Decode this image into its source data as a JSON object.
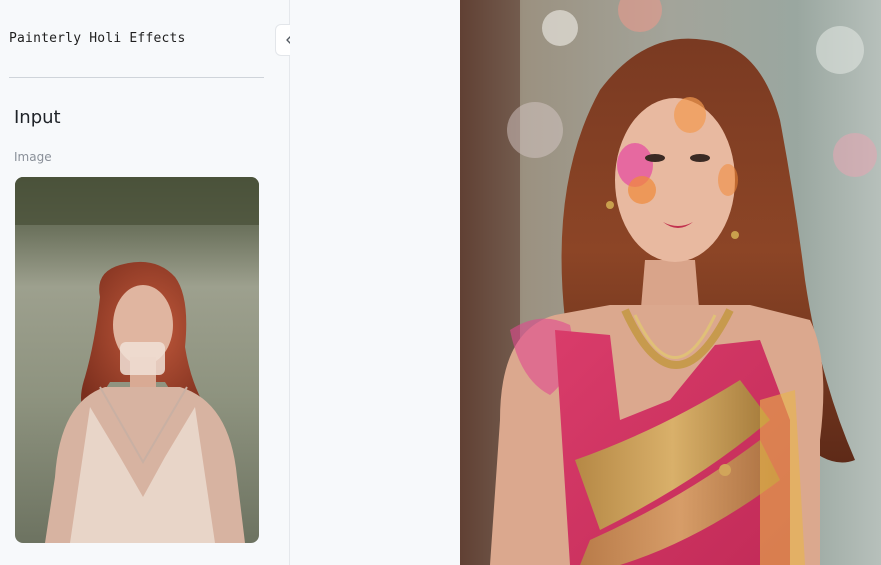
{
  "app": {
    "title": "Painterly Holi Effects"
  },
  "sidebar": {
    "section_heading": "Input",
    "image_field_label": "Image"
  },
  "icons": {
    "collapse": "chevrons-left-icon"
  },
  "colors": {
    "sidebar_bg": "#f7f9fb",
    "divider": "#cfd4da",
    "text_primary": "#1f2328",
    "text_muted": "#8a9099"
  }
}
